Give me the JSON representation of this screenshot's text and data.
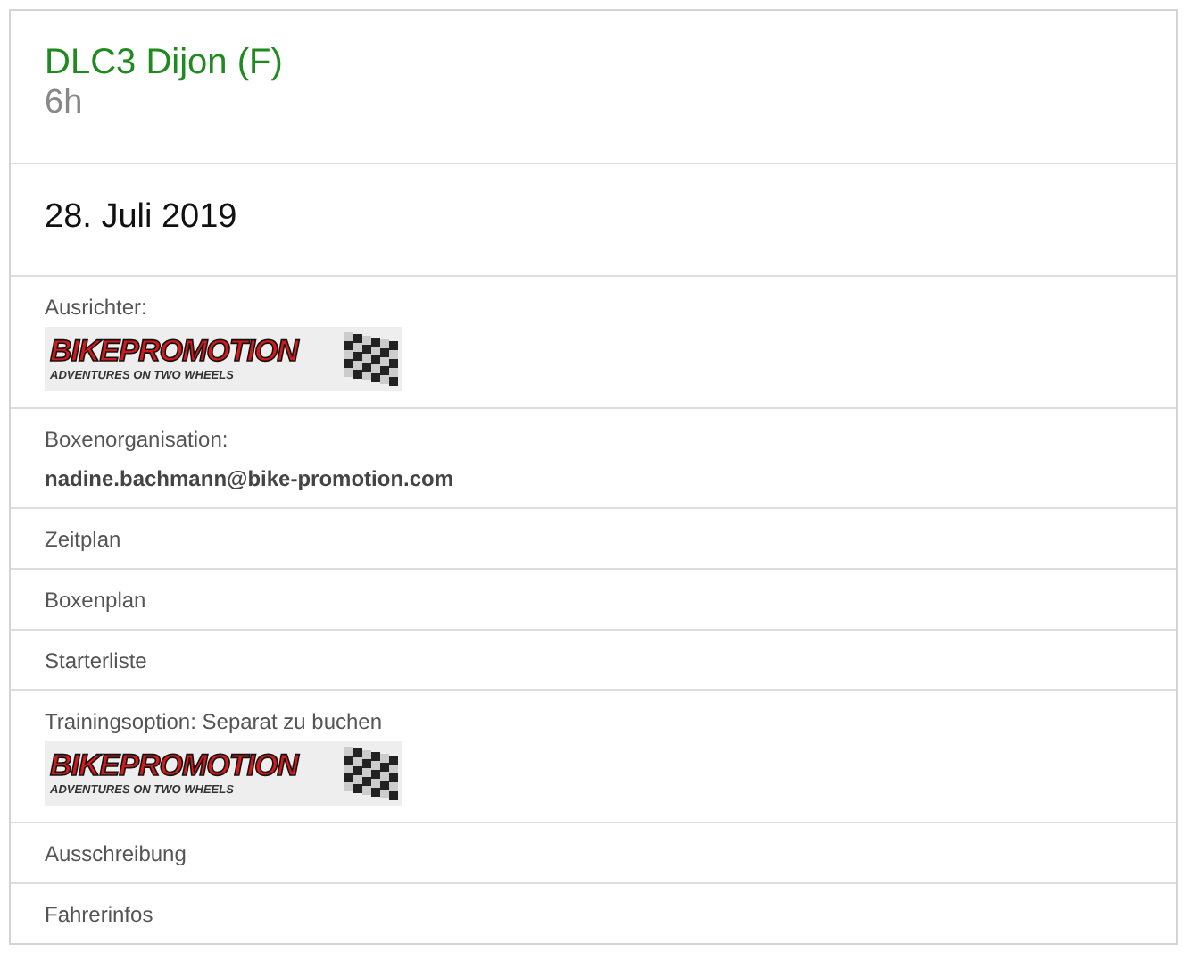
{
  "event": {
    "title": "DLC3 Dijon (F)",
    "duration": "6h"
  },
  "date": "28. Juli 2019",
  "rows": [
    {
      "kind": "logo",
      "label": "Ausrichter:",
      "logo": {
        "wordmark": "BIKEPROMOTION",
        "tagline": "ADVENTURES ON TWO WHEELS"
      }
    },
    {
      "kind": "email",
      "label": "Boxenorganisation:",
      "value": "nadine.bachmann@bike-promotion.com"
    },
    {
      "kind": "link",
      "label": "Zeitplan"
    },
    {
      "kind": "link",
      "label": "Boxenplan"
    },
    {
      "kind": "link",
      "label": "Starterliste"
    },
    {
      "kind": "logo",
      "label": "Trainingsoption: Separat zu buchen",
      "logo": {
        "wordmark": "BIKEPROMOTION",
        "tagline": "ADVENTURES ON TWO WHEELS"
      }
    },
    {
      "kind": "link",
      "label": "Ausschreibung"
    },
    {
      "kind": "link",
      "label": "Fahrerinfos"
    }
  ]
}
